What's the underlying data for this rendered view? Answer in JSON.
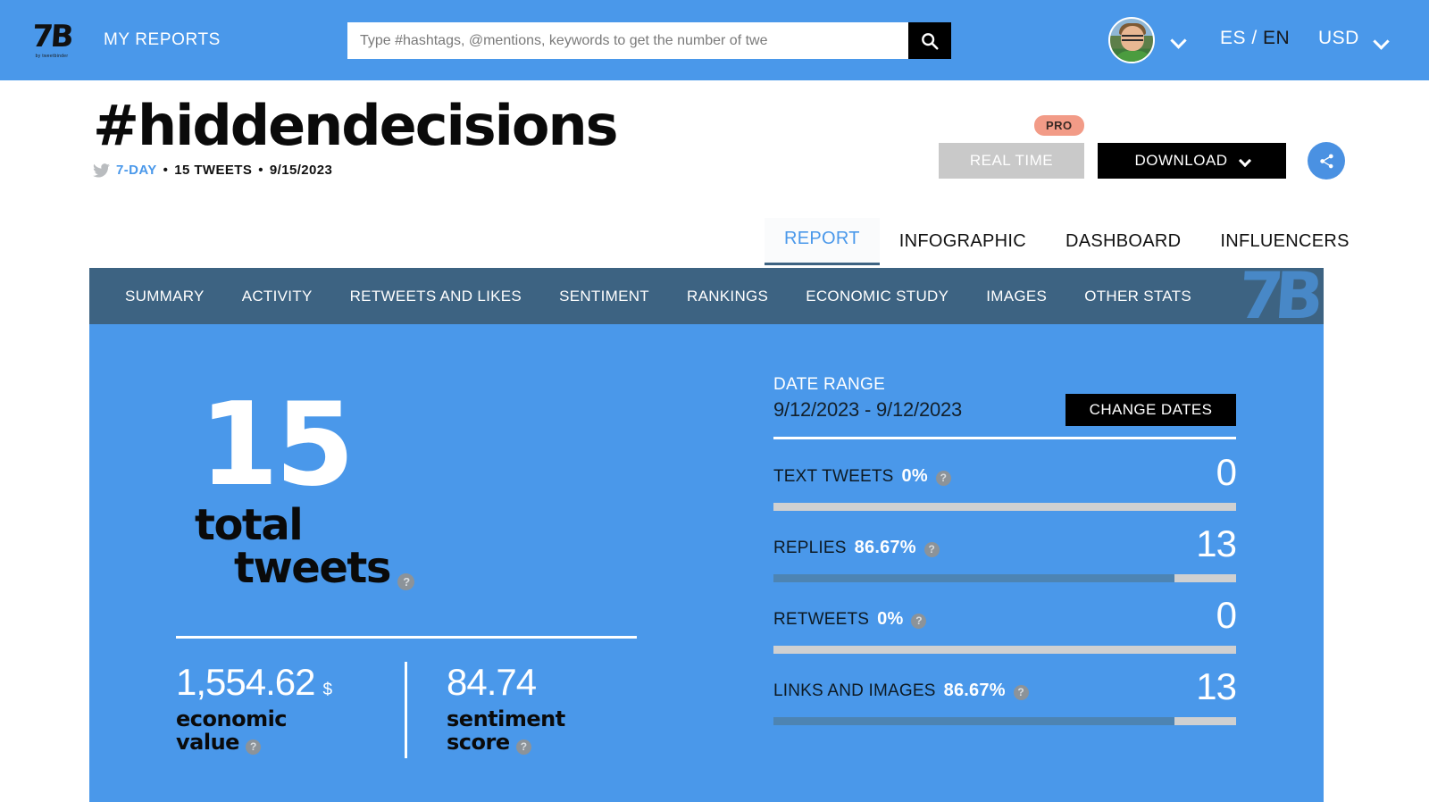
{
  "header": {
    "logo_mark": "7B",
    "logo_sub": "by tweetbinder",
    "my_reports_label": "MY REPORTS",
    "search_placeholder": "Type #hashtags, @mentions, keywords to get the number of twe",
    "search_value": "",
    "lang_es": "ES",
    "lang_sep": "/",
    "lang_en": "EN",
    "currency": "USD"
  },
  "report": {
    "title": "#hiddendecisions",
    "meta_days": "7-DAY",
    "meta_tweets": "15 TWEETS",
    "meta_date": "9/15/2023",
    "dot": "•"
  },
  "actions": {
    "pro_badge": "PRO",
    "real_time": "REAL TIME",
    "download": "DOWNLOAD"
  },
  "main_tabs": [
    {
      "label": "REPORT",
      "active": true
    },
    {
      "label": "INFOGRAPHIC",
      "active": false
    },
    {
      "label": "DASHBOARD",
      "active": false
    },
    {
      "label": "INFLUENCERS",
      "active": false
    }
  ],
  "sub_nav": {
    "items": [
      {
        "label": "SUMMARY"
      },
      {
        "label": "ACTIVITY"
      },
      {
        "label": "RETWEETS AND LIKES"
      },
      {
        "label": "SENTIMENT"
      },
      {
        "label": "RANKINGS"
      },
      {
        "label": "ECONOMIC STUDY"
      },
      {
        "label": "IMAGES"
      },
      {
        "label": "OTHER STATS"
      }
    ],
    "watermark": "7B"
  },
  "summary": {
    "total_value": "15",
    "total_label_line1": "total",
    "total_label_line2": "tweets",
    "help": "?",
    "economic_value": "1,554.62",
    "economic_currency": "$",
    "economic_label_line1": "economic",
    "economic_label_line2": "value",
    "sentiment_value": "84.74",
    "sentiment_label_line1": "sentiment",
    "sentiment_label_line2": "score"
  },
  "date_range": {
    "label": "DATE RANGE",
    "value": "9/12/2023 - 9/12/2023",
    "change_button": "CHANGE DATES"
  },
  "metrics": [
    {
      "name": "TEXT TWEETS",
      "pct": "0%",
      "count": "0",
      "fill": 0
    },
    {
      "name": "REPLIES",
      "pct": "86.67%",
      "count": "13",
      "fill": 86.67
    },
    {
      "name": "RETWEETS",
      "pct": "0%",
      "count": "0",
      "fill": 0
    },
    {
      "name": "LINKS AND IMAGES",
      "pct": "86.67%",
      "count": "13",
      "fill": 86.67
    }
  ],
  "colors": {
    "brand_blue": "#4a98ea",
    "nav_slate": "#3d6382",
    "pro_salmon": "#f29b87",
    "bar_fill": "#4d84b3",
    "bar_track": "#cfd0d1"
  }
}
